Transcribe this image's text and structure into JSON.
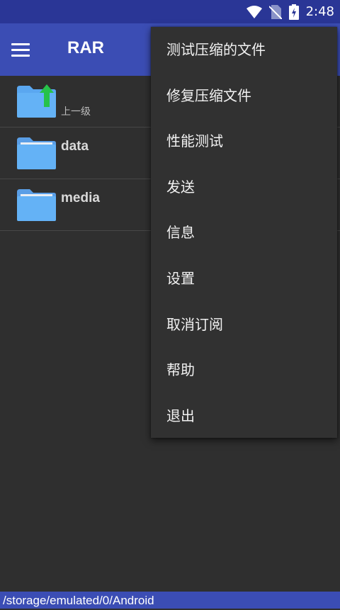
{
  "status_bar": {
    "time": "2:48"
  },
  "app_bar": {
    "title": "RAR"
  },
  "files": [
    {
      "name": "",
      "subtitle": "上一级"
    },
    {
      "name": "data"
    },
    {
      "name": "media"
    }
  ],
  "menu": {
    "items": [
      "测试压缩的文件",
      "修复压缩文件",
      "性能测试",
      "发送",
      "信息",
      "设置",
      "取消订阅",
      "帮助",
      "退出"
    ]
  },
  "path_bar": {
    "path": "/storage/emulated/0/Android"
  },
  "colors": {
    "status_bar": "#2a3696",
    "app_bar": "#3b4db4",
    "background": "#2f2f2f",
    "folder": "#5aa7f0",
    "up_arrow": "#26c24a"
  }
}
